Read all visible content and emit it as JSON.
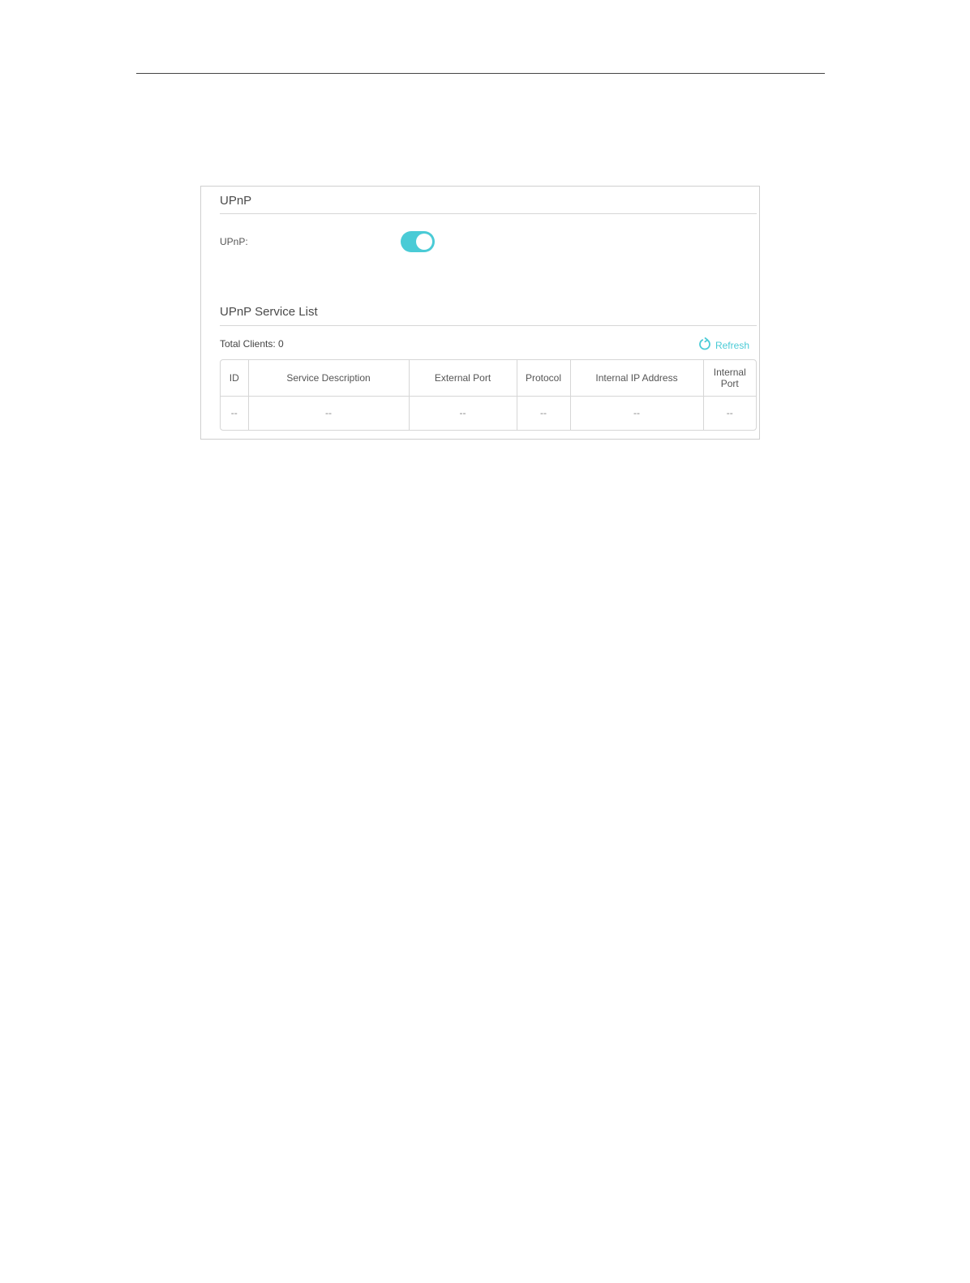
{
  "upnp_section": {
    "title": "UPnP",
    "field_label": "UPnP:",
    "toggle_enabled": true,
    "accent_color": "#4acbd6"
  },
  "service_list": {
    "title": "UPnP Service List",
    "total_clients": "Total Clients: 0",
    "refresh_label": "Refresh",
    "refresh_icon": "refresh-icon",
    "columns": [
      "ID",
      "Service Description",
      "External Port",
      "Protocol",
      "Internal IP Address",
      "Internal Port"
    ],
    "rows": [
      [
        "--",
        "--",
        "--",
        "--",
        "--",
        "--"
      ]
    ]
  }
}
